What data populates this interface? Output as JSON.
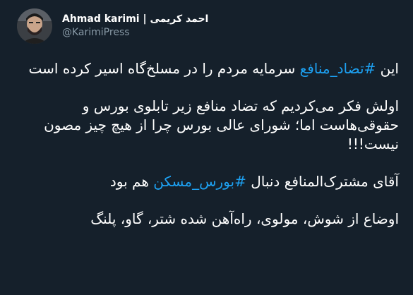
{
  "user": {
    "display_name": "Ahmad karimi | احمد کریمی",
    "handle": "@KarimiPress",
    "avatar_icon": "profile-photo"
  },
  "tweet": {
    "p1": {
      "prefix": "این ",
      "hashtag": "#تضاد_منافع",
      "suffix": " سرمایه مردم را در مسلخ‌گاه اسیر کرده است"
    },
    "p2": "اولش فکر می‌کردیم که تضاد منافع زیر تابلوی بورس و حقوقی‌هاست اما؛ شورای عالی بورس چرا از هیچ چیز مصون نیست!!!",
    "p3": {
      "prefix": "آقای مشترک‌المنافع دنبال ",
      "hashtag": "#بورس_مسکن",
      "suffix": " هم بود"
    },
    "p4": "اوضاع از شوش، مولوی، راه‌آهن شده شتر، گاو، پلنگ"
  },
  "colors": {
    "background": "#15202b",
    "text": "#ffffff",
    "secondary": "#8899a6",
    "link": "#1da1f2"
  }
}
